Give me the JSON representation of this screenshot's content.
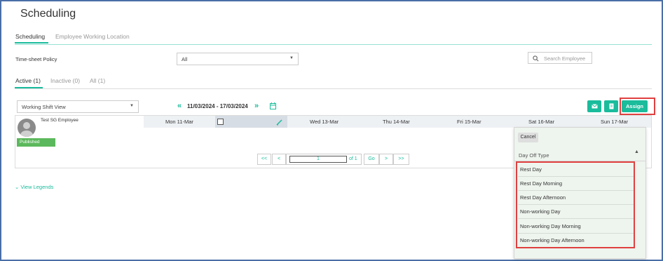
{
  "page": {
    "title": "Scheduling"
  },
  "tabs": [
    {
      "label": "Scheduling",
      "active": true
    },
    {
      "label": "Employee Working Location",
      "active": false
    }
  ],
  "filter": {
    "label": "Time-sheet Policy",
    "value": "All"
  },
  "search": {
    "placeholder": "Search Employee"
  },
  "status_tabs": [
    {
      "label": "Active (1)",
      "active": true
    },
    {
      "label": "Inactive (0)",
      "active": false
    },
    {
      "label": "All (1)",
      "active": false
    }
  ],
  "view": {
    "value": "Working Shift View"
  },
  "date_range": "11/03/2024 - 17/03/2024",
  "toolbar": {
    "assign_label": "Assign"
  },
  "days": [
    "Mon 11-Mar",
    "Wed 13-Mar",
    "Thu 14-Mar",
    "Fri 15-Mar",
    "Sat 16-Mar",
    "Sun 17-Mar"
  ],
  "employee": {
    "name": "Test SG Employee",
    "status": "Published"
  },
  "pager": {
    "first": "<<",
    "prev": "<",
    "page": "1",
    "of": "of 1",
    "go": "Go",
    "next": ">",
    "last": ">>"
  },
  "legends": {
    "label": "View Legends"
  },
  "dropdown": {
    "cancel": "Cancel",
    "header": "Day Off Type",
    "options": [
      "Rest Day",
      "Rest Day Morning",
      "Rest Day Afternoon",
      "Non-working Day",
      "Non-working Day Morning",
      "Non-working Day Afternoon"
    ]
  },
  "colors": {
    "accent": "#1abc9c",
    "published": "#5cb85c",
    "highlight": "#e04040"
  }
}
